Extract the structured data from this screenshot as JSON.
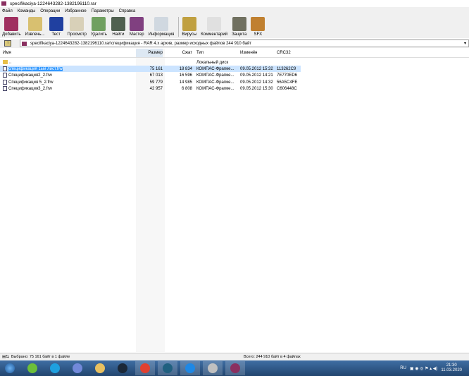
{
  "window": {
    "title": "specifikaciya-1224643282-1382196110.rar"
  },
  "menu": [
    "Файл",
    "Команды",
    "Операции",
    "Избранное",
    "Параметры",
    "Справка"
  ],
  "toolbar": [
    {
      "label": "Добавить",
      "icon": "add-archive-icon",
      "color": "#a03060"
    },
    {
      "label": "Извлечь...",
      "icon": "extract-icon",
      "color": "#d8c070"
    },
    {
      "label": "Тест",
      "icon": "test-icon",
      "color": "#2040a0"
    },
    {
      "label": "Просмотр",
      "icon": "view-icon",
      "color": "#d8d0b8"
    },
    {
      "label": "Удалить",
      "icon": "delete-icon",
      "color": "#70a060"
    },
    {
      "label": "Найти",
      "icon": "find-icon",
      "color": "#506050"
    },
    {
      "label": "Мастер",
      "icon": "wizard-icon",
      "color": "#804080"
    },
    {
      "label": "Информация",
      "icon": "info-icon",
      "color": "#d0d8e0"
    },
    {
      "label": "Вирусы",
      "icon": "virus-scan-icon",
      "color": "#c0a040"
    },
    {
      "label": "Комментарий",
      "icon": "comment-icon",
      "color": "#e0e0e0"
    },
    {
      "label": "Защита",
      "icon": "protect-icon",
      "color": "#707060"
    },
    {
      "label": "SFX",
      "icon": "sfx-icon",
      "color": "#c08030"
    }
  ],
  "address": {
    "path": "specifikaciya-1224643282-1382196110.rar\\спецификация - RAR 4.x архив, размер исходных файлов 244 910 байт"
  },
  "columns": {
    "name": "Имя",
    "size": "Размер",
    "packed": "Сжат",
    "type": "Тип",
    "modified": "Изменён",
    "crc": "CRC32"
  },
  "parent": {
    "name": "..",
    "type": "Локальный диск"
  },
  "files": [
    {
      "name": "спецификация 1ый лист.frw",
      "size": "75 161",
      "packed": "18 834",
      "type": "КОМПАС-Фрагме...",
      "modified": "09.05.2012 15:32",
      "crc": "113262C9",
      "selected": true
    },
    {
      "name": "Спецификация2_2.frw",
      "size": "67 013",
      "packed": "16 596",
      "type": "КОМПАС-Фрагме...",
      "modified": "09.05.2012 14:21",
      "crc": "7E770ED6"
    },
    {
      "name": "Спецификация 5_2.frw",
      "size": "59 779",
      "packed": "14 985",
      "type": "КОМПАС-Фрагме...",
      "modified": "09.05.2012 14:32",
      "crc": "56A5C4FE"
    },
    {
      "name": "Спецификация3_2.frw",
      "size": "42 957",
      "packed": "6 808",
      "type": "КОМПАС-Фрагме...",
      "modified": "09.05.2012 15:30",
      "crc": "C606448C"
    }
  ],
  "status": {
    "selected": "Выбрано: 75 161 байт в 1 файле",
    "total": "Всего: 244 910 байт в 4 файлах"
  },
  "taskbar": {
    "apps": [
      {
        "icon": "utorrent-icon",
        "color": "#6cbf3a"
      },
      {
        "icon": "skype-icon",
        "color": "#1ea0e0"
      },
      {
        "icon": "discord-icon",
        "color": "#7289da"
      },
      {
        "icon": "explorer-icon",
        "color": "#e8c060"
      },
      {
        "icon": "steam-icon",
        "color": "#1b2838"
      },
      {
        "icon": "chrome-icon",
        "color": "#e04030"
      },
      {
        "icon": "kompas-icon",
        "color": "#206080"
      },
      {
        "icon": "heart-app-icon",
        "color": "#1e88e5"
      },
      {
        "icon": "tool-app-icon",
        "color": "#c0c0c0"
      },
      {
        "icon": "winrar-icon",
        "color": "#8a3060"
      }
    ],
    "lang": "RU",
    "time": "21:30",
    "date": "11.03.2020"
  }
}
